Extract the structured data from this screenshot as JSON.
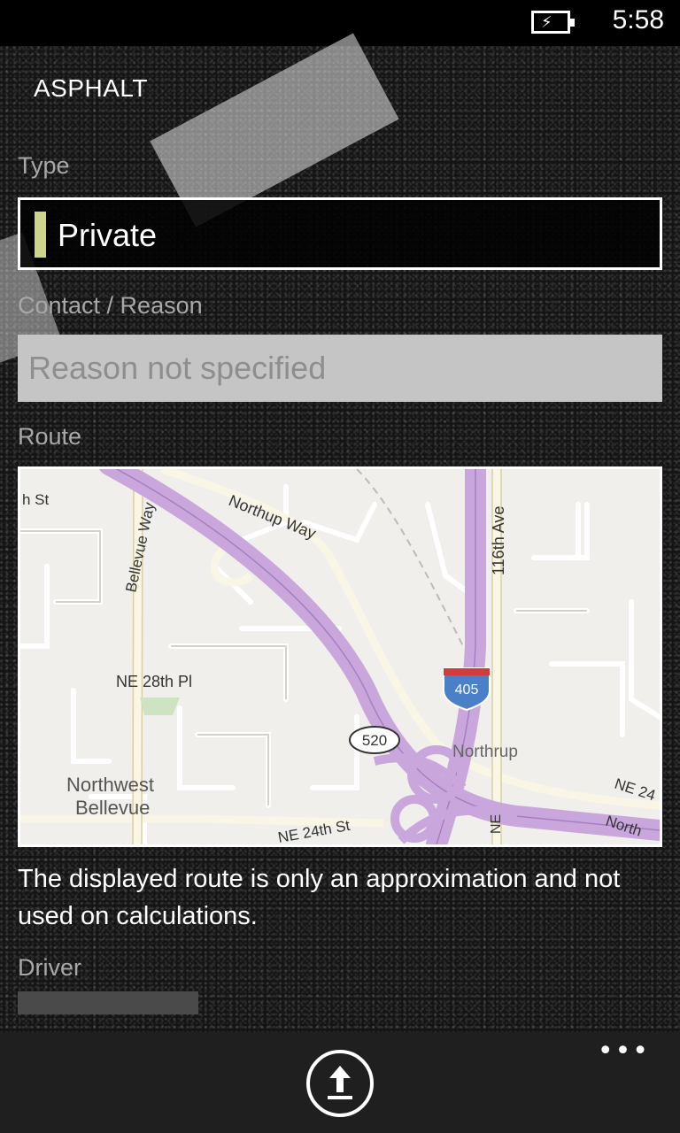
{
  "status_bar": {
    "time": "5:58",
    "battery_icon": "battery-charging-icon"
  },
  "app": {
    "title": "ASPHALT"
  },
  "form": {
    "type_label": "Type",
    "type_value": "Private",
    "type_accent_color": "#cdd58a",
    "reason_label": "Contact / Reason",
    "reason_placeholder": "Reason not specified",
    "reason_value": "",
    "route_label": "Route",
    "route_note": "The displayed route is only an approximation and not used on calculations.",
    "driver_label": "Driver"
  },
  "map": {
    "labels": {
      "st": "h St",
      "bellevue_way": "Bellevue Way",
      "northup_way": "Northup Way",
      "ave_116th": "116th Ave",
      "ne_28th_pl": "NE 28th Pl",
      "i405": "405",
      "sr520": "520",
      "northrup": "Northrup",
      "northwest": "Northwest",
      "bellevue": "Bellevue",
      "ne_24th_st": "NE 24th St",
      "ne_24_right": "NE 24",
      "north_right": "North",
      "ne_vertical": "NE"
    },
    "highway_color": "#c9a7dc"
  },
  "app_bar": {
    "more_label": "•••",
    "upload_icon": "upload-icon"
  }
}
